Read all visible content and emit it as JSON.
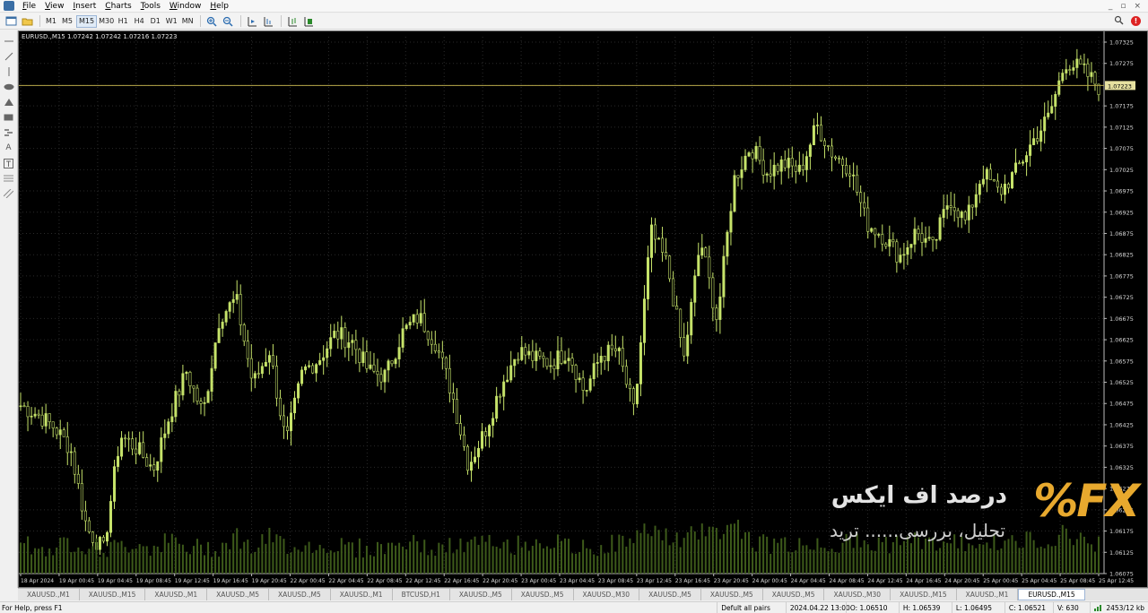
{
  "menu": [
    "File",
    "View",
    "Insert",
    "Charts",
    "Tools",
    "Window",
    "Help"
  ],
  "window_controls": [
    "_",
    "▫",
    "×"
  ],
  "toolbar": {
    "timeframes": [
      "M1",
      "M5",
      "M15",
      "M30",
      "H1",
      "H4",
      "D1",
      "W1",
      "MN"
    ],
    "active_timeframe": "M15"
  },
  "chart": {
    "title": "EURUSD.,M15  1.07242 1.07242 1.07216 1.07223",
    "current_price": "1.07223",
    "colors": {
      "background": "#000000",
      "grid": "#2a2a2a",
      "bar": "#c6e36a",
      "volume": "#3d5a1a",
      "price_line": "#b8a84a"
    }
  },
  "chart_data": {
    "type": "candlestick",
    "symbol": "EURUSD.",
    "timeframe": "M15",
    "ylim": [
      1.06075,
      1.07325
    ],
    "y_ticks": [
      "1.07325",
      "1.07275",
      "1.07223",
      "1.07175",
      "1.07125",
      "1.07075",
      "1.07025",
      "1.06975",
      "1.06925",
      "1.06875",
      "1.06825",
      "1.06775",
      "1.06725",
      "1.06675",
      "1.06625",
      "1.06575",
      "1.06525",
      "1.06475",
      "1.06425",
      "1.06375",
      "1.06325",
      "1.06275",
      "1.06225",
      "1.06175",
      "1.06125",
      "1.06075"
    ],
    "x_ticks": [
      "18 Apr 2024",
      "19 Apr 00:45",
      "19 Apr 04:45",
      "19 Apr 08:45",
      "19 Apr 12:45",
      "19 Apr 16:45",
      "19 Apr 20:45",
      "22 Apr 00:45",
      "22 Apr 04:45",
      "22 Apr 08:45",
      "22 Apr 12:45",
      "22 Apr 16:45",
      "22 Apr 20:45",
      "23 Apr 00:45",
      "23 Apr 04:45",
      "23 Apr 08:45",
      "23 Apr 12:45",
      "23 Apr 16:45",
      "23 Apr 20:45",
      "24 Apr 00:45",
      "24 Apr 04:45",
      "24 Apr 08:45",
      "24 Apr 12:45",
      "24 Apr 16:45",
      "24 Apr 20:45",
      "25 Apr 00:45",
      "25 Apr 04:45",
      "25 Apr 08:45",
      "25 Apr 12:45"
    ],
    "close_path": [
      1.0647,
      1.0645,
      1.0642,
      1.0637,
      1.0618,
      1.0613,
      1.064,
      1.0637,
      1.0632,
      1.0645,
      1.0655,
      1.0645,
      1.0668,
      1.0672,
      1.0652,
      1.066,
      1.0638,
      1.0655,
      1.0658,
      1.0664,
      1.0662,
      1.0655,
      1.0654,
      1.0664,
      1.0668,
      1.0662,
      1.065,
      1.0633,
      1.0641,
      1.0652,
      1.066,
      1.0658,
      1.0657,
      1.066,
      1.065,
      1.0659,
      1.066,
      1.0645,
      1.0688,
      1.068,
      1.0658,
      1.0686,
      1.0667,
      1.07,
      1.0708,
      1.0702,
      1.0704,
      1.0702,
      1.0713,
      1.0706,
      1.0703,
      1.069,
      1.0687,
      1.0682,
      1.0688,
      1.0684,
      1.0696,
      1.069,
      1.0702,
      1.0697,
      1.0702,
      1.0709,
      1.0715,
      1.0728,
      1.0726,
      1.0722
    ],
    "volume_level": [
      0.55,
      0.3,
      0.35,
      0.45,
      0.4,
      0.3,
      0.35,
      0.45,
      0.35,
      0.5,
      0.3,
      0.35,
      0.35,
      0.6,
      0.3,
      0.55,
      0.4,
      0.4,
      0.35,
      0.4,
      0.35,
      0.3,
      0.35,
      0.45,
      0.4,
      0.3,
      0.35,
      0.4,
      0.45,
      0.35,
      0.4,
      0.5,
      0.45,
      0.35,
      0.3,
      0.35,
      0.45,
      0.5,
      0.8,
      0.55,
      0.45,
      0.75,
      0.65,
      0.9,
      0.5,
      0.4,
      0.45,
      0.35,
      0.45,
      0.4,
      0.45,
      0.4,
      0.45,
      0.4,
      0.5,
      0.45,
      0.4,
      0.45,
      0.5,
      0.4,
      0.45,
      0.5,
      0.55,
      0.65,
      0.5,
      0.45
    ]
  },
  "watermark": {
    "brand": "%FX",
    "title": "درصد اف ایکس",
    "subtitle": "تحلیل، بررسی...... ترید"
  },
  "tabs": [
    "XAUUSD.,M1",
    "XAUUSD.,M15",
    "XAUUSD.,M1",
    "XAUUSD.,M5",
    "XAUUSD.,M5",
    "XAUUSD.,M1",
    "BTCUSD,H1",
    "XAUUSD.,M5",
    "XAUUSD.,M5",
    "XAUUSD.,M30",
    "XAUUSD.,M5",
    "XAUUSD.,M5",
    "XAUUSD.,M5",
    "XAUUSD.,M30",
    "XAUUSD.,M15",
    "XAUUSD.,M1",
    "EURUSD.,M15"
  ],
  "active_tab_index": 16,
  "status": {
    "help": "For Help, press F1",
    "profile": "Defult all pairs",
    "datetime": "2024.04.22 13:00",
    "open": "O: 1.06510",
    "high": "H: 1.06539",
    "low": "L: 1.06495",
    "close": "C: 1.06521",
    "volume": "V: 630",
    "traffic": "2453/12 kb"
  }
}
